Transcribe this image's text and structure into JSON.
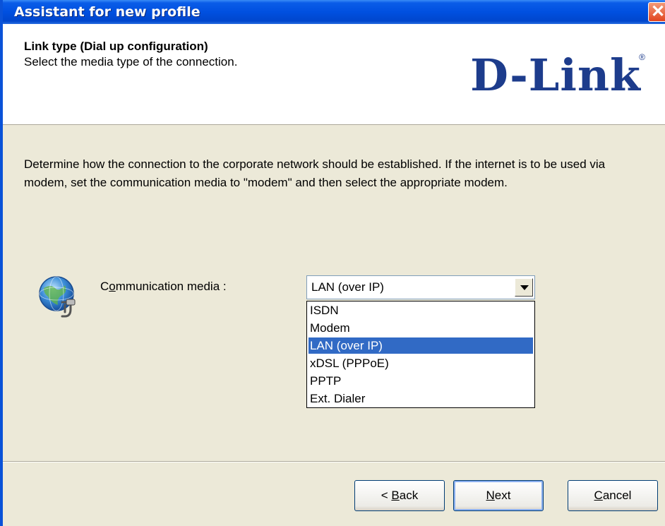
{
  "window": {
    "title": "Assistant for new profile",
    "close_icon": "close-icon"
  },
  "header": {
    "title": "Link type (Dial up configuration)",
    "subtitle": "Select the media type of the connection.",
    "logo_text": "D-Link",
    "logo_registered": "®"
  },
  "description": "Determine how the connection to the corporate network should be established. If the internet is to be used via modem, set the communication media to \"modem\" and then select the appropriate modem.",
  "media": {
    "label_pre": "C",
    "label_access": "o",
    "label_post": "mmunication media :",
    "selected": "LAN (over IP)",
    "options": [
      "ISDN",
      "Modem",
      "LAN (over IP)",
      "xDSL (PPPoE)",
      "PPTP",
      "Ext. Dialer"
    ],
    "selected_index": 2
  },
  "buttons": {
    "back_prefix": "< ",
    "back_access": "B",
    "back_rest": "ack",
    "next_access": "N",
    "next_rest": "ext",
    "cancel_access": "C",
    "cancel_rest": "ancel"
  },
  "colors": {
    "titlebar": "#0050e0",
    "selection": "#316ac5",
    "logo": "#1d3c8c"
  }
}
